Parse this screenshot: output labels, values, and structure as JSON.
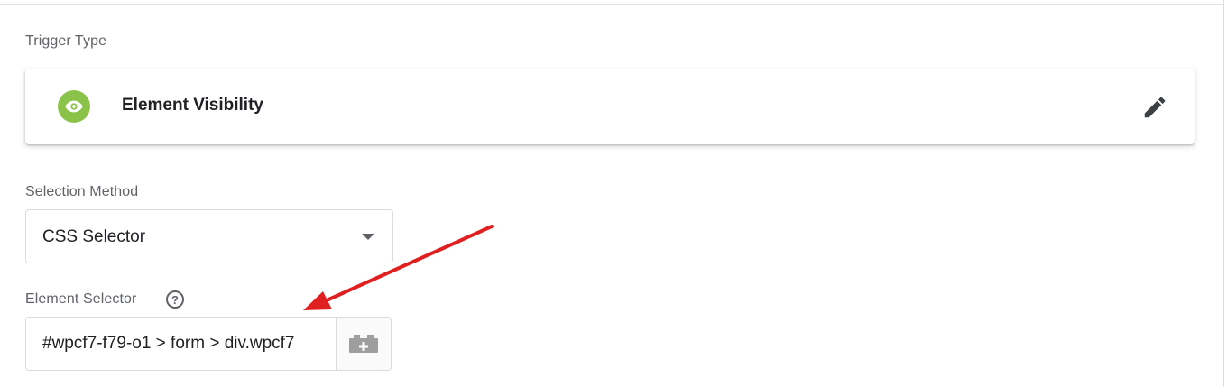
{
  "trigger_type": {
    "label": "Trigger Type",
    "name": "Element Visibility",
    "icon": "eye-icon",
    "icon_color": "#8bc34a"
  },
  "selection_method": {
    "label": "Selection Method",
    "value": "CSS Selector"
  },
  "element_selector": {
    "label": "Element Selector",
    "value": "#wpcf7-f79-o1 > form > div.wpcf7"
  },
  "annotation": {
    "arrow_color": "#e02020"
  }
}
